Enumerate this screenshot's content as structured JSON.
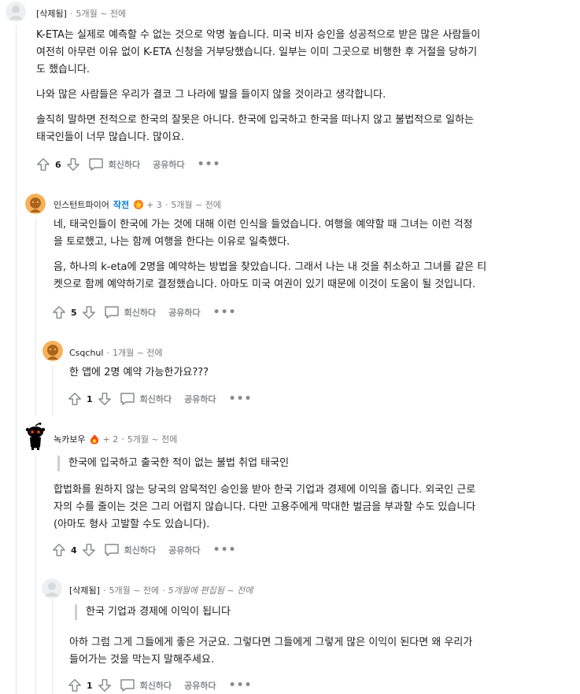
{
  "actions": {
    "reply_label": "회신하다",
    "share_label": "공유하다",
    "more_label": "•••"
  },
  "comments": [
    {
      "author": "[삭제됨]",
      "time": "5개월 ~ 전에",
      "votes": "6",
      "paragraphs": [
        "K-ETA는 실제로 예측할 수 없는 것으로 악명 높습니다. 미국 비자 승인을 성공적으로 받은 많은 사람들이\n여전히 아무런 이유 없이 K-ETA 신청을 거부당했습니다. 일부는 이미 그곳으로 비행한 후 거절을 당하기\n도 했습니다.",
        "나와 많은 사람들은 우리가 결코 그 나라에 발을 들이지 않을 것이라고 생각합니다.",
        "솔직히 말하면 전적으로 한국의 잘못은 아니다. 한국에 입국하고 한국을 떠나지 않고 불법적으로 일하는\n태국인들이 너무 많습니다. 많이요."
      ]
    },
    {
      "author": "인스턴트파이어",
      "op_label": "작전",
      "karma": "+ 3",
      "time": "5개월 ~ 전에",
      "votes": "5",
      "paragraphs": [
        "네, 태국인들이 한국에 가는 것에 대해 이런 인식을 들었습니다. 여행을 예약할 때 그녀는 이런 걱정\n을 토로했고, 나는 함께 여행을 한다는 이유로 일축했다.",
        "음, 하나의 k-eta에 2명을 예약하는 방법을 찾았습니다. 그래서 나는 내 것을 취소하고 그녀를 같은 티\n켓으로 함께 예약하기로 결정했습니다. 아마도 미국 여권이 있기 때문에 이것이 도움이 될 것입니다."
      ]
    },
    {
      "author": "Csqchul",
      "time": "1개월 ~ 전에",
      "votes": "1",
      "paragraphs": [
        "한 앱에 2명 예약 가능한가요???"
      ]
    },
    {
      "author": "녹카보우",
      "karma": "+ 2",
      "time": "5개월 ~ 전에",
      "votes": "4",
      "quote": "한국에 입국하고 출국한 적이 없는 불법 취업 태국인",
      "paragraphs": [
        "합법화를 원하지 않는 당국의 암묵적인 승인을 받아 한국 기업과 경제에 이익을 줍니다. 외국인 근로\n자의 수를 줄이는 것은 그리 어렵지 않습니다. 다만 고용주에게 막대한 벌금을 부과할 수도 있습니다\n(아마도 형사 고발할 수도 있습니다)."
      ]
    },
    {
      "author": "[삭제됨]",
      "time": "5개월 ~ 전에",
      "edited": "5개월에 편집됨 ~ 전에",
      "votes": "1",
      "quote": "한국 기업과 경제에 이익이 됩니다",
      "paragraphs": [
        "아하 그럼 그게 그들에게 좋은 거군요. 그렇다면 그들에게 그렇게 많은 이익이 된다면 왜 우리가\n들어가는 것을 막는지 말해주세요."
      ]
    }
  ]
}
